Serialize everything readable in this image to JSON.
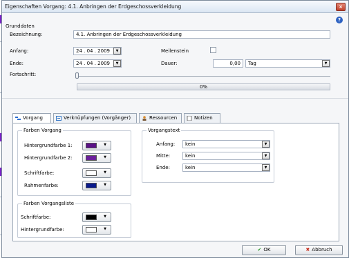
{
  "window": {
    "title": "Eigenschaften Vorgang: 4.1. Anbringen der Erdgeschossverkleidung",
    "close_glyph": "×",
    "help_glyph": "?"
  },
  "grunddaten": {
    "section_label": "Grunddaten",
    "bezeichnung_label": "Bezeichnung:",
    "bezeichnung_value": "4.1. Anbringen der Erdgeschossverkleidung",
    "anfang_label": "Anfang:",
    "anfang_value": "24 . 04 . 2009",
    "ende_label": "Ende:",
    "ende_value": "24 . 04 . 2009",
    "meilenstein_label": "Meilenstein",
    "meilenstein_checked": false,
    "dauer_label": "Dauer:",
    "dauer_value": "0,00",
    "dauer_unit": "Tag",
    "fortschritt_label": "Fortschritt:",
    "fortschritt_percent": "0%",
    "fortschritt_fraction": 0
  },
  "tabs": [
    {
      "label": "Vorgang",
      "icon": "task-icon",
      "active": true
    },
    {
      "label": "Verknüpfungen (Vorgänger)",
      "icon": "link-icon",
      "active": false
    },
    {
      "label": "Ressourcen",
      "icon": "resources-icon",
      "active": false
    },
    {
      "label": "Notizen",
      "icon": "notes-icon",
      "active": false
    }
  ],
  "farben_vorgang": {
    "title": "Farben Vorgang",
    "hintergrund1_label": "Hintergrundfarbe 1:",
    "hintergrund1_color": "#5b1287",
    "hintergrund2_label": "Hintergrundfarbe 2:",
    "hintergrund2_color": "#6a1f9a",
    "schrift_label": "Schriftfarbe:",
    "schrift_color": "#ffffff",
    "rahmen_label": "Rahmenfarbe:",
    "rahmen_color": "#0a1a8c"
  },
  "farben_vorgangsliste": {
    "title": "Farben Vorgangsliste",
    "schrift_label": "Schriftfarbe:",
    "schrift_color": "#000000",
    "hintergrund_label": "Hintergrundfarbe:",
    "hintergrund_color": "#ffffff"
  },
  "vorgangstext": {
    "title": "Vorgangstext",
    "anfang_label": "Anfang:",
    "anfang_value": "kein",
    "mitte_label": "Mitte:",
    "mitte_value": "kein",
    "ende_label": "Ende:",
    "ende_value": "kein"
  },
  "buttons": {
    "ok_label": "OK",
    "abbruch_label": "Abbruch"
  },
  "colors": {
    "ok_check": "#2e9a2e",
    "cancel_x": "#c62a1a"
  }
}
